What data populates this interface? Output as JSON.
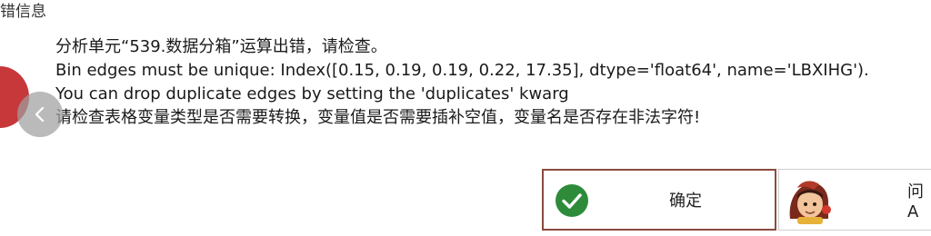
{
  "dialog": {
    "title": "错信息",
    "message_lines": [
      "分析单元“539.数据分箱”运算出错，请检查。",
      "Bin edges must be unique: Index([0.15, 0.19, 0.19, 0.22, 17.35], dtype='float64', name='LBXIHG').",
      "You can drop duplicate edges by setting the 'duplicates' kwarg",
      "请检查表格变量类型是否需要转换，变量值是否需要插补空值，变量名是否存在非法字符!"
    ]
  },
  "buttons": {
    "ok_label": "确定",
    "ask_label": "问A"
  },
  "icons": {
    "ok": "check-circle-icon",
    "ask": "assistant-avatar-icon",
    "nav": "chevron-left-icon"
  },
  "colors": {
    "ok_icon": "#2e8b3a",
    "ok_border": "#8b4a3f",
    "blob": "#c7383a"
  }
}
